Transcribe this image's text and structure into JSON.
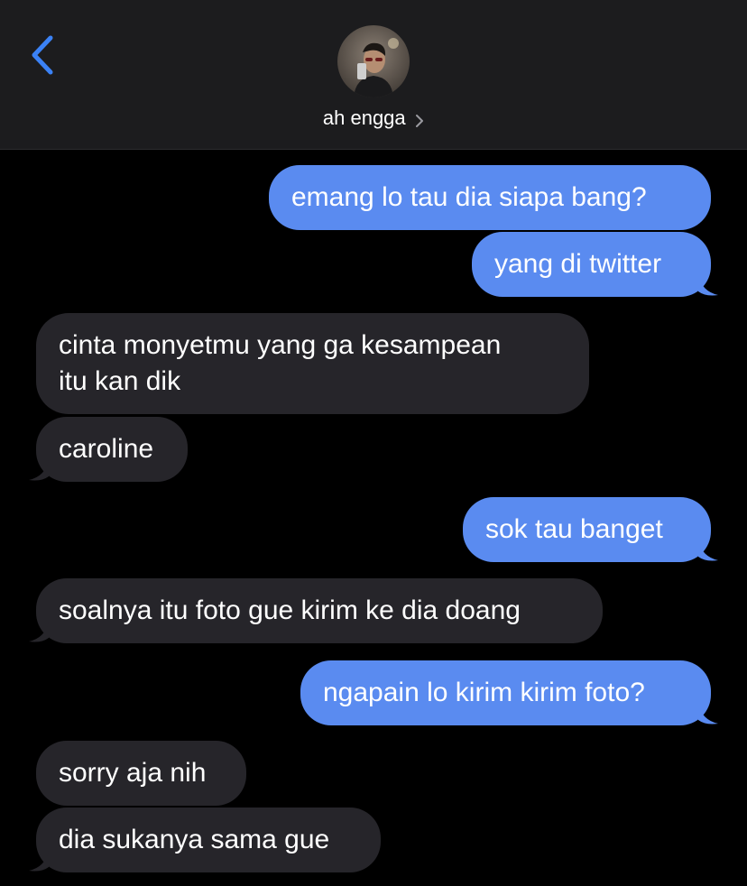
{
  "contact": {
    "name": "ah engga"
  },
  "messages": [
    {
      "dir": "out",
      "text": "emang lo tau dia siapa bang?"
    },
    {
      "dir": "out",
      "text": "yang di twitter"
    },
    {
      "dir": "in",
      "text": "cinta monyetmu yang ga kesampean\nitu kan dik"
    },
    {
      "dir": "in",
      "text": "caroline"
    },
    {
      "dir": "out",
      "text": "sok tau banget"
    },
    {
      "dir": "in",
      "text": "soalnya itu foto gue kirim ke dia doang"
    },
    {
      "dir": "out",
      "text": "ngapain lo kirim kirim foto?"
    },
    {
      "dir": "in",
      "text": "sorry aja nih"
    },
    {
      "dir": "in",
      "text": "dia sukanya sama gue"
    }
  ],
  "colors": {
    "outgoing": "#5a8bf0",
    "incoming": "#26252a",
    "accent": "#3b82f6"
  }
}
